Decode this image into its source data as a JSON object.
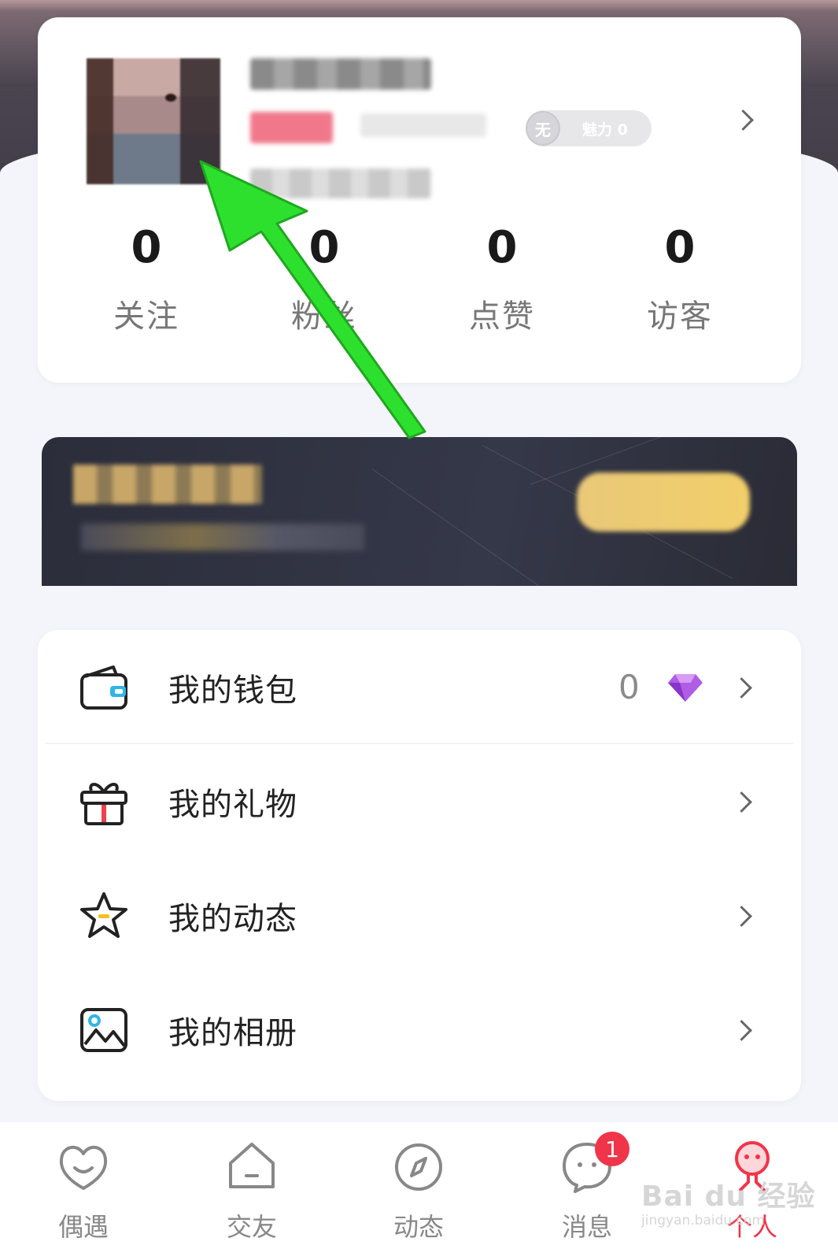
{
  "profile": {
    "charm_prefix": "无",
    "charm_label": "魅力 0",
    "stats": [
      {
        "value": "0",
        "label": "关注"
      },
      {
        "value": "0",
        "label": "粉丝"
      },
      {
        "value": "0",
        "label": "点赞"
      },
      {
        "value": "0",
        "label": "访客"
      }
    ]
  },
  "menu": {
    "items": [
      {
        "label": "我的钱包",
        "icon": "wallet-icon",
        "value": "0"
      },
      {
        "label": "我的礼物",
        "icon": "gift-icon"
      },
      {
        "label": "我的动态",
        "icon": "star-icon"
      },
      {
        "label": "我的相册",
        "icon": "album-icon"
      }
    ]
  },
  "tabbar": {
    "tabs": [
      {
        "label": "偶遇",
        "icon": "heart-smile-icon"
      },
      {
        "label": "交友",
        "icon": "house-icon"
      },
      {
        "label": "动态",
        "icon": "compass-icon"
      },
      {
        "label": "消息",
        "icon": "chat-icon",
        "badge": "1"
      },
      {
        "label": "个人",
        "icon": "person-icon",
        "active": true
      }
    ]
  },
  "watermark": {
    "main": "Bai du 经验",
    "sub": "jingyan.baidu.com"
  },
  "colors": {
    "accent": "#f0344a",
    "arrow": "#2ee02e",
    "tag_pink": "#f0788a",
    "gem": "#a34de0"
  }
}
